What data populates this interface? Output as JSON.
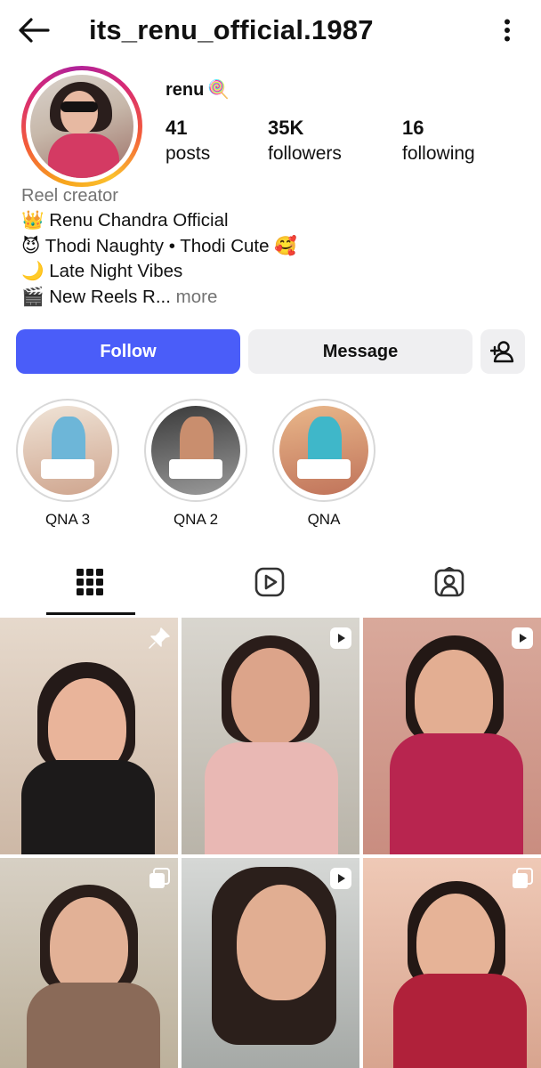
{
  "header": {
    "username": "its_renu_official.1987",
    "back_icon": "arrow-left-icon",
    "menu_icon": "more-vertical-icon"
  },
  "profile": {
    "display_name": "renu",
    "name_emoji": "🍭",
    "stats": {
      "posts_count": "41",
      "posts_label": "posts",
      "followers_count": "35K",
      "followers_label": "followers",
      "following_count": "16",
      "following_label": "following"
    },
    "story_ring_colors": [
      "#f7a41d",
      "#f35b3a",
      "#d62976",
      "#b0239a"
    ]
  },
  "bio": {
    "category": "Reel creator",
    "lines": [
      "👑 Renu Chandra Official",
      "😈 Thodi Naughty • Thodi Cute 🥰",
      "🌙 Late Night Vibes",
      "🎬 New Reels R..."
    ],
    "more_label": " more"
  },
  "actions": {
    "follow_label": "Follow",
    "message_label": "Message",
    "add_user_icon": "person-add-icon",
    "follow_color": "#4a5df9"
  },
  "highlights": [
    {
      "label": "QNA 3"
    },
    {
      "label": "QNA 2"
    },
    {
      "label": "QNA"
    }
  ],
  "tabs": [
    {
      "icon": "grid-icon",
      "active": true
    },
    {
      "icon": "reels-icon",
      "active": false
    },
    {
      "icon": "tagged-icon",
      "active": false
    }
  ],
  "posts": [
    {
      "badge": "pin-icon"
    },
    {
      "badge": "reel-icon"
    },
    {
      "badge": "reel-icon"
    },
    {
      "badge": "carousel-icon"
    },
    {
      "badge": "reel-icon"
    },
    {
      "badge": "carousel-icon"
    }
  ]
}
